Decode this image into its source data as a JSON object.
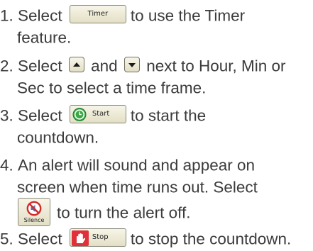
{
  "steps": [
    {
      "number": "1.",
      "before": "Select",
      "button_label": "Timer",
      "after": "to use the Timer",
      "cont": "feature."
    },
    {
      "number": "2.",
      "before": "Select",
      "middle": "and",
      "after": "next to Hour, Min or",
      "cont": "Sec to select a time frame."
    },
    {
      "number": "3.",
      "before": "Select",
      "button_label": "Start",
      "after": "to start the",
      "cont": "countdown."
    },
    {
      "number": "4.",
      "line1": "An alert will sound and appear on",
      "line2": "screen when time runs out. Select",
      "button_label": "Silence",
      "after": "to turn the alert off."
    },
    {
      "number": "5.",
      "before": "Select",
      "button_label": "Stop",
      "after": "to stop the countdown."
    }
  ],
  "icons": {
    "up_arrow": "up-arrow-icon",
    "down_arrow": "down-arrow-icon",
    "start": "clock-icon",
    "silence": "no-sound-icon",
    "stop": "hand-stop-icon"
  },
  "colors": {
    "text": "#3b3b3b",
    "button_bg": "#efecd6",
    "button_border": "#8a8a7a",
    "start_icon": "#2e9b3a",
    "stop_icon": "#e0303a",
    "silence_icon": "#d42a2a"
  }
}
